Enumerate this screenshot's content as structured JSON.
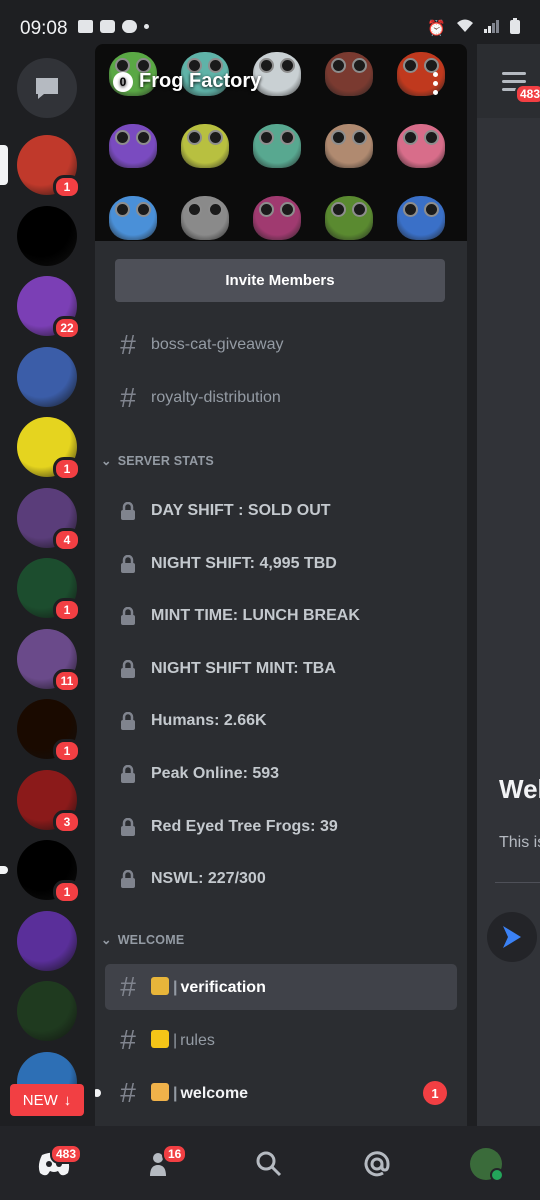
{
  "status_bar": {
    "time": "09:08"
  },
  "server_rail": {
    "servers": [
      {
        "name": "server-robot",
        "badge": "1",
        "color": "#c0392b",
        "selected": true
      },
      {
        "name": "server-dream-skate",
        "badge": "",
        "color": "#000000"
      },
      {
        "name": "server-king-cat",
        "badge": "22",
        "color": "#7b3fb5"
      },
      {
        "name": "server-warrior",
        "badge": "",
        "color": "#3b5da8"
      },
      {
        "name": "server-lizard",
        "badge": "1",
        "color": "#e5d41f"
      },
      {
        "name": "server-angel-mouse",
        "badge": "4",
        "color": "#5a3d7a"
      },
      {
        "name": "server-gentlemens-club",
        "badge": "1",
        "color": "#1c4d2e"
      },
      {
        "name": "server-guitarist",
        "badge": "11",
        "color": "#6a4a8a"
      },
      {
        "name": "server-voyager",
        "badge": "1",
        "color": "#1a0a00"
      },
      {
        "name": "server-skull-hat",
        "badge": "3",
        "color": "#8b1a1a"
      },
      {
        "name": "server-aikiri",
        "badge": "1",
        "color": "#000000",
        "unread": true
      },
      {
        "name": "server-alien",
        "badge": "",
        "color": "#5a2f9a"
      },
      {
        "name": "server-cyber-soldier",
        "badge": "",
        "color": "#1f3a1f"
      },
      {
        "name": "server-clown",
        "badge": "",
        "color": "#2d6fb5"
      }
    ],
    "new_button": "NEW"
  },
  "server": {
    "name": "Frog Factory",
    "boost_level": "0",
    "invite_label": "Invite Members",
    "frog_colors": [
      "#5aa845",
      "#5fb3a8",
      "#c9d0d3",
      "#7a3a30",
      "#c0391e",
      "#7a4bc0",
      "#b8c040",
      "#58a890",
      "#b08a70",
      "#d86d8a",
      "#4a90d8",
      "#8a8a8a",
      "#a03a70",
      "#5a8a30",
      "#3a70c8"
    ]
  },
  "channels_top": [
    {
      "name": "boss-cat-giveaway",
      "locked": true
    },
    {
      "name": "royalty-distribution"
    }
  ],
  "categories": {
    "server_stats": "SERVER STATS",
    "welcome": "WELCOME"
  },
  "stats": [
    "DAY SHIFT : SOLD OUT",
    "NIGHT SHIFT: 4,995 TBD",
    "MINT TIME: LUNCH BREAK",
    "NIGHT SHIFT MINT: TBA",
    "Humans: 2.66K",
    "Peak Online: 593",
    "Red Eyed Tree Frogs: 39",
    "NSWL: 227/300"
  ],
  "welcome_channels": [
    {
      "name": "verification",
      "emoji_color": "#e8b53a",
      "active": true
    },
    {
      "name": "rules",
      "emoji_color": "#f5c518"
    },
    {
      "name": "welcome",
      "emoji_color": "#f0b24a",
      "badge": "1",
      "unread": true
    }
  ],
  "right_panel": {
    "heading": "Wel",
    "subtext": "This is",
    "badge": "483"
  },
  "bottom_nav": {
    "home_badge": "483",
    "friends_badge": "16"
  }
}
